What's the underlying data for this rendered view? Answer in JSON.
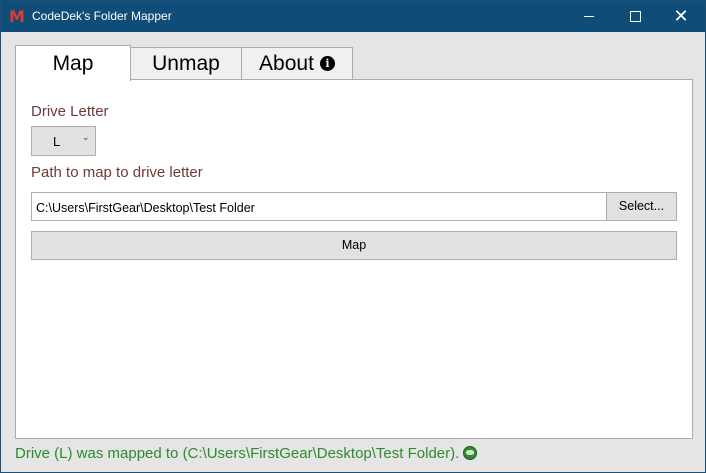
{
  "window": {
    "title": "CodeDek's Folder Mapper",
    "icon_letter": "M",
    "controls": {
      "minimize": "minimize-icon",
      "maximize": "maximize-icon",
      "close": "close-icon"
    }
  },
  "tabs": [
    {
      "label": "Map",
      "active": true
    },
    {
      "label": "Unmap",
      "active": false
    },
    {
      "label": "About",
      "active": false,
      "icon": "info-icon"
    }
  ],
  "map_panel": {
    "drive_letter_label": "Drive Letter",
    "drive_letter_value": "L",
    "path_label": "Path to map to drive letter",
    "path_value": "C:\\Users\\FirstGear\\Desktop\\Test Folder",
    "select_button": "Select...",
    "map_button": "Map"
  },
  "status": {
    "message": "Drive (L) was mapped to (C:\\Users\\FirstGear\\Desktop\\Test Folder).",
    "icon": "globe-icon",
    "color": "#2e8b2e"
  },
  "colors": {
    "titlebar": "#0f4c78",
    "label": "#6e3b3b"
  }
}
